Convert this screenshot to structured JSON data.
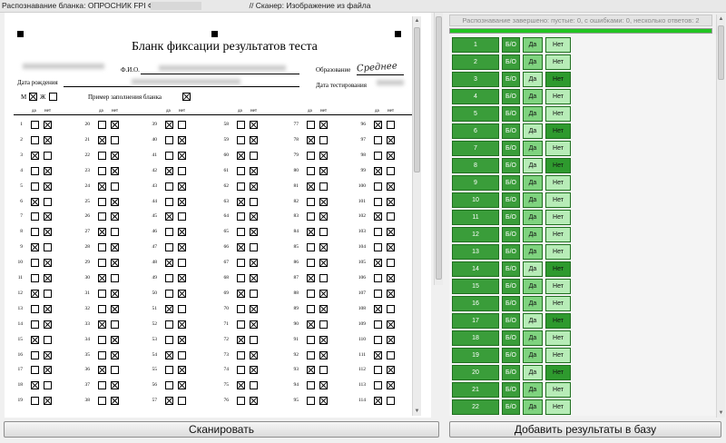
{
  "window": {
    "title": "Распознавание бланка: ОПРОСНИК FPI ФОРМА В дл",
    "title_suffix": "// Сканер: Изображение из файла"
  },
  "scan": {
    "form_title": "Бланк фиксации результатов теста",
    "fio_label": "Ф.И.О.",
    "education_label": "Образование",
    "education_value": "Среднее",
    "birthdate_label": "Дата рождения",
    "testdate_label": "Дата тестирования",
    "gender_m": "М",
    "gender_f": "Ж",
    "example_label": "Пример заполнения бланка",
    "col_yes": "да",
    "col_no": "нет",
    "columns": [
      {
        "start": 1,
        "end": 19
      },
      {
        "start": 20,
        "end": 38
      },
      {
        "start": 39,
        "end": 57
      },
      {
        "start": 58,
        "end": 76
      },
      {
        "start": 77,
        "end": 95
      },
      {
        "start": 96,
        "end": 114
      }
    ]
  },
  "status_text": "Распознавание завершено: пустые: 0, с ошибками: 0, несколько ответов: 2",
  "progress_percent": 100,
  "answer_labels": {
    "bo": "Б/О",
    "yes": "Да",
    "no": "Нет"
  },
  "answers": [
    {
      "n": "1",
      "sel": "no"
    },
    {
      "n": "2",
      "sel": "no"
    },
    {
      "n": "3",
      "sel": "yes"
    },
    {
      "n": "4",
      "sel": "no"
    },
    {
      "n": "5",
      "sel": "no"
    },
    {
      "n": "6",
      "sel": "yes"
    },
    {
      "n": "7",
      "sel": "no"
    },
    {
      "n": "8",
      "sel": "yes"
    },
    {
      "n": "9",
      "sel": "no"
    },
    {
      "n": "10",
      "sel": "no"
    },
    {
      "n": "11",
      "sel": "no"
    },
    {
      "n": "12",
      "sel": "no"
    },
    {
      "n": "13",
      "sel": "no"
    },
    {
      "n": "14",
      "sel": "yes"
    },
    {
      "n": "15",
      "sel": "no"
    },
    {
      "n": "16",
      "sel": "no"
    },
    {
      "n": "17",
      "sel": "yes"
    },
    {
      "n": "18",
      "sel": "no"
    },
    {
      "n": "19",
      "sel": "no"
    },
    {
      "n": "20",
      "sel": "yes"
    },
    {
      "n": "21",
      "sel": "no"
    },
    {
      "n": "22",
      "sel": "no"
    }
  ],
  "buttons": {
    "scan": "Сканировать",
    "add": "Добавить результаты в базу"
  }
}
